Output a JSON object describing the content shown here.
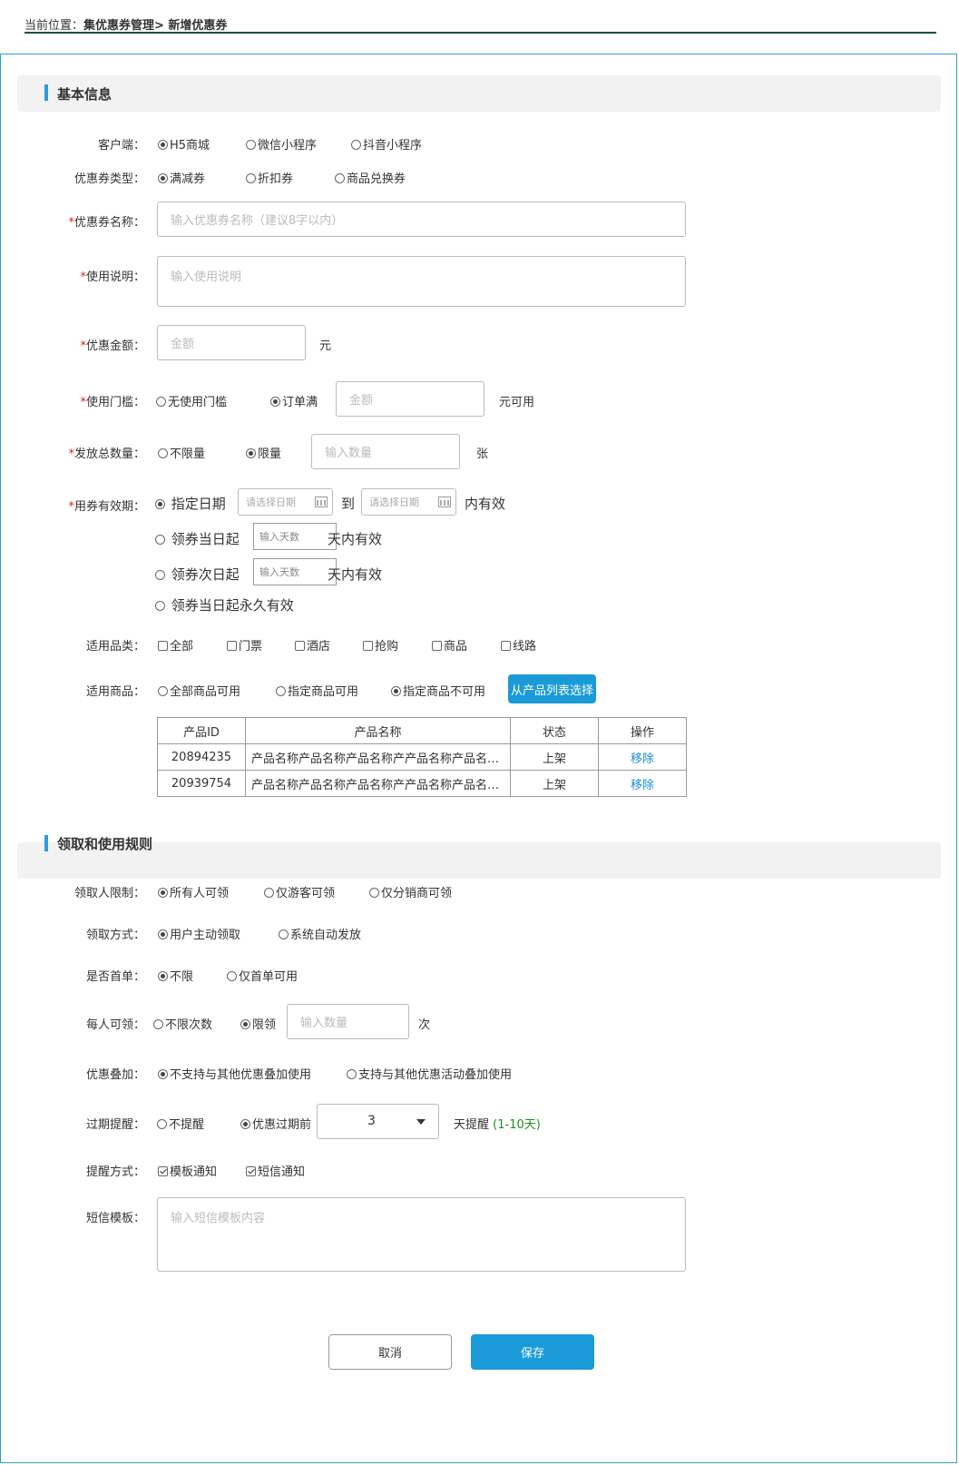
{
  "breadcrumb": {
    "prefix": "当前位置：",
    "path": "集优惠券管理> 新增优惠券"
  },
  "basic": {
    "title": "基本信息",
    "client": {
      "label": "客户端：",
      "options": [
        "H5商城",
        "微信小程序",
        "抖音小程序"
      ],
      "selected": 0
    },
    "type": {
      "label": "优惠券类型：",
      "options": [
        "满减券",
        "折扣券",
        "商品兑换券"
      ],
      "selected": 0
    },
    "name": {
      "star": "*",
      "label": "优惠券名称：",
      "placeholder": "输入优惠券名称（建议8字以内）"
    },
    "desc": {
      "star": "*",
      "label": "使用说明：",
      "placeholder": "输入使用说明"
    },
    "amount": {
      "star": "*",
      "label": "优惠金额：",
      "placeholder": "金额",
      "unit": "元"
    },
    "threshold": {
      "star": "*",
      "label": "使用门槛：",
      "options": [
        "无使用门槛",
        "订单满"
      ],
      "selected": 1,
      "placeholder": "金额",
      "unit": "元可用"
    },
    "total": {
      "star": "*",
      "label": "发放总数量：",
      "options": [
        "不限量",
        "限量"
      ],
      "selected": 1,
      "placeholder": "输入数量",
      "unit": "张"
    },
    "validity": {
      "star": "*",
      "label": "用券有效期：",
      "opt1": "指定日期",
      "date_placeholder": "请选择日期",
      "to": "到",
      "suffix1": "内有效",
      "opt2": "领券当日起",
      "opt3": "领券次日起",
      "days_placeholder": "输入天数",
      "suffix2": "天内有效",
      "opt4": "领券当日起永久有效",
      "selected": 0
    },
    "category": {
      "label": "适用品类：",
      "options": [
        "全部",
        "门票",
        "酒店",
        "抢购",
        "商品",
        "线路"
      ]
    },
    "goods": {
      "label": "适用商品：",
      "options": [
        "全部商品可用",
        "指定商品可用",
        "指定商品不可用"
      ],
      "selected": 2,
      "button": "从产品列表选择"
    },
    "table": {
      "headers": [
        "产品ID",
        "产品名称",
        "状态",
        "操作"
      ],
      "rows": [
        {
          "id": "20894235",
          "name": "产品名称产品名称产品名称产产品名称产品名称产品名称",
          "status": "上架",
          "action": "移除"
        },
        {
          "id": "20939754",
          "name": "产品名称产品名称产品名称产产品名称产品名称产品名称",
          "status": "上架",
          "action": "移除"
        }
      ]
    }
  },
  "rules": {
    "title": "领取和使用规则",
    "who": {
      "label": "领取人限制：",
      "options": [
        "所有人可领",
        "仅游客可领",
        "仅分销商可领"
      ],
      "selected": 0
    },
    "method": {
      "label": "领取方式：",
      "options": [
        "用户主动领取",
        "系统自动发放"
      ],
      "selected": 0
    },
    "first": {
      "label": "是否首单：",
      "options": [
        "不限",
        "仅首单可用"
      ],
      "selected": 0
    },
    "per": {
      "label": "每人可领：",
      "options": [
        "不限次数",
        "限领"
      ],
      "selected": 1,
      "placeholder": "输入数量",
      "unit": "次"
    },
    "stack": {
      "label": "优惠叠加：",
      "options": [
        "不支持与其他优惠叠加使用",
        "支持与其他优惠活动叠加使用"
      ],
      "selected": 0
    },
    "expire": {
      "label": "过期提醒：",
      "options": [
        "不提醒",
        "优惠过期前"
      ],
      "selected": 1,
      "value": "3",
      "unit": "天提醒",
      "hint": "(1-10天)"
    },
    "notify": {
      "label": "提醒方式：",
      "options": [
        "模板通知",
        "短信通知"
      ],
      "checked": [
        true,
        true
      ]
    },
    "sms": {
      "label": "短信模板：",
      "placeholder": "输入短信模板内容"
    }
  },
  "actions": {
    "cancel": "取消",
    "save": "保存"
  }
}
